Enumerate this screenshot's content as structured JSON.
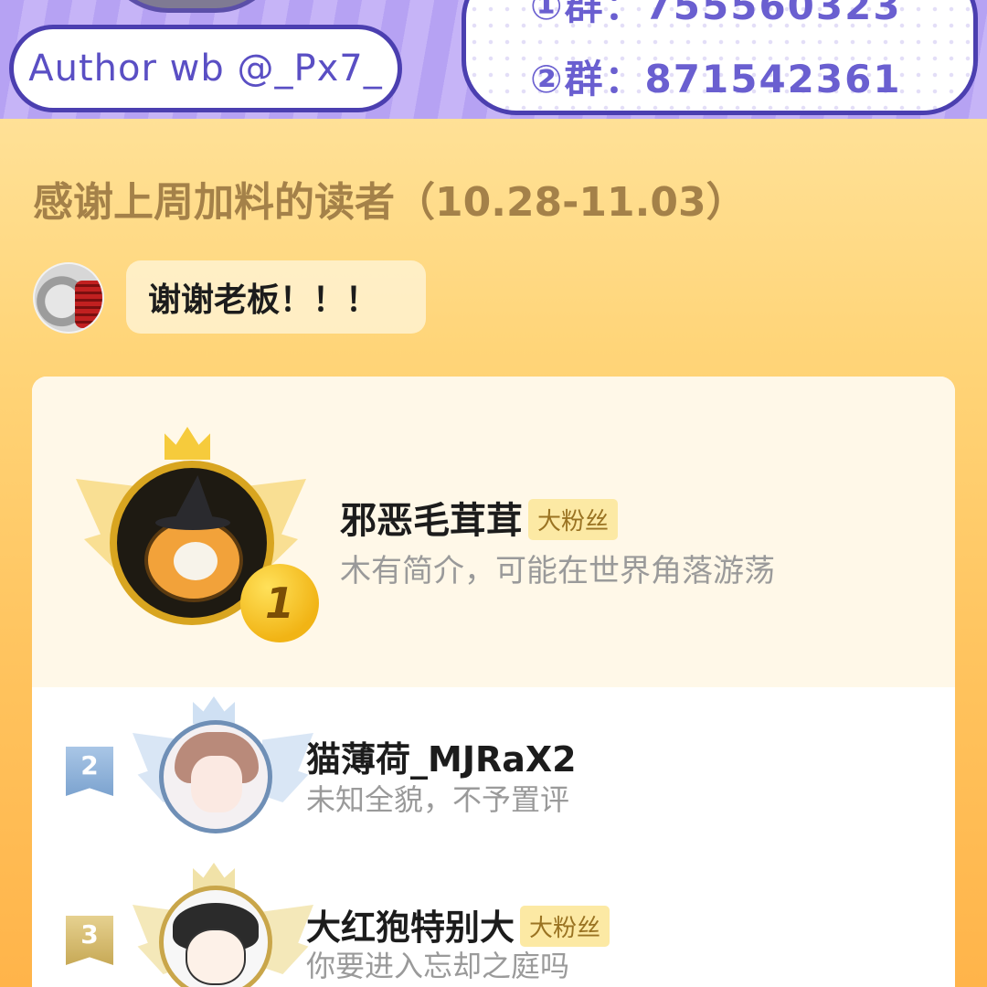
{
  "banner": {
    "author": "Author wb @_Px7_",
    "groups": [
      "①群：755560323",
      "②群：871542361"
    ]
  },
  "section": {
    "title": "感谢上周加料的读者（10.28-11.03）"
  },
  "speech": {
    "text": "谢谢老板！！！"
  },
  "ranking": [
    {
      "rank": "1",
      "name": "邪恶毛茸茸",
      "badge": "大粉丝",
      "bio": "木有简介，可能在世界角落游荡"
    },
    {
      "rank": "2",
      "name": "猫薄荷_MJRaX2",
      "badge": "",
      "bio": "未知全貌，不予置评"
    },
    {
      "rank": "3",
      "name": "大红狍特别大",
      "badge": "大粉丝",
      "bio": "你要进入忘却之庭吗"
    }
  ],
  "colors": {
    "banner_purple": "#b6a2f3",
    "banner_border": "#4b3fb0",
    "title_brown": "#a48149",
    "badge_bg": "#fce9a4",
    "badge_text": "#9a7322",
    "gold": "#f1b415",
    "silver_blue": "#7ca3cf",
    "bronze": "#c7a956"
  }
}
